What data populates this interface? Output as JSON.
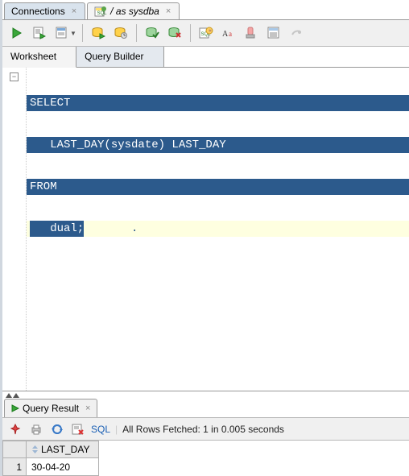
{
  "tabs": {
    "connections": "Connections",
    "active": "/ as sysdba"
  },
  "sub_tabs": {
    "worksheet": "Worksheet",
    "query_builder": "Query Builder"
  },
  "sql": {
    "line1": "SELECT",
    "line2": "   LAST_DAY(sysdate) LAST_DAY",
    "line3": "FROM",
    "line4_hl": "   dual;",
    "line4_caret": "       ."
  },
  "result": {
    "tab_label": "Query Result",
    "sql_link": "SQL",
    "status": "All Rows Fetched: 1 in 0.005 seconds",
    "column": "LAST_DAY",
    "row_num": "1",
    "cell": "30-04-20"
  },
  "glyphs": {
    "close": "×",
    "minus": "−"
  }
}
